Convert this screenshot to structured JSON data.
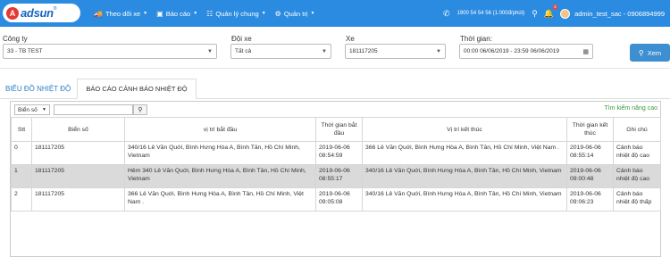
{
  "brand": {
    "mark": "A",
    "name": "adsun",
    "reg": "®"
  },
  "nav": [
    {
      "icon": "🚚",
      "label": "Theo dõi xe"
    },
    {
      "icon": "▣",
      "label": "Báo cáo"
    },
    {
      "icon": "☷",
      "label": "Quản lý chung"
    },
    {
      "icon": "⚙",
      "label": "Quản trị"
    }
  ],
  "header": {
    "hotline": "1900 54 54 56 (1.000đ/phút)",
    "notification_count": "2",
    "user": "admin_test_sac - 0906894999"
  },
  "filters": {
    "company_label": "Công ty",
    "company_value": "33 - TB TEST",
    "team_label": "Đội xe",
    "team_value": "Tất cả",
    "vehicle_label": "Xe",
    "vehicle_value": "181117205",
    "time_label": "Thời gian:",
    "time_value": "00:00 06/06/2019 - 23:59 06/06/2019",
    "search_button": "Xem"
  },
  "tabs": {
    "tab1": "BIỂU ĐỒ NHIỆT ĐỘ",
    "tab2": "BÁO CÁO CẢNH BÁO NHIỆT ĐỘ"
  },
  "search": {
    "field": "Biển số",
    "advanced": "Tìm kiếm nâng cao"
  },
  "table": {
    "headers": [
      "Stt",
      "Biển số",
      "vị trí bắt đầu",
      "Thời gian bắt đầu",
      "Vị trí kết thúc",
      "Thời gian kết thúc",
      "Ghi chú"
    ],
    "rows": [
      [
        "0",
        "181117205",
        "340/16 Lê Văn Quới, Bình Hưng Hòa A, Bình Tân, Hồ Chí Minh, Vietnam",
        "2019-06-06 08:54:59",
        "366 Lê Văn Quới, Bình Hưng Hòa A, Bình Tân, Hồ Chí Minh, Việt Nam .",
        "2019-06-06 08:55:14",
        "Cảnh báo nhiệt độ cao"
      ],
      [
        "1",
        "181117205",
        "Hẻm 340 Lê Văn Quới, Bình Hưng Hòa A, Bình Tân, Hồ Chí Minh, Vietnam",
        "2019-06-06 08:55:17",
        "340/16 Lê Văn Quới, Bình Hưng Hòa A, Bình Tân, Hồ Chí Minh, Vietnam",
        "2019-06-06 09:00:48",
        "Cảnh báo nhiệt độ cao"
      ],
      [
        "2",
        "181117205",
        "366 Lê Văn Quới, Bình Hưng Hòa A, Bình Tân, Hồ Chí Minh, Việt Nam .",
        "2019-06-06 09:05:08",
        "340/16 Lê Văn Quới, Bình Hưng Hòa A, Bình Tân, Hồ Chí Minh, Vietnam",
        "2019-06-06 09:06:23",
        "Cảnh báo nhiệt độ thấp"
      ]
    ]
  }
}
